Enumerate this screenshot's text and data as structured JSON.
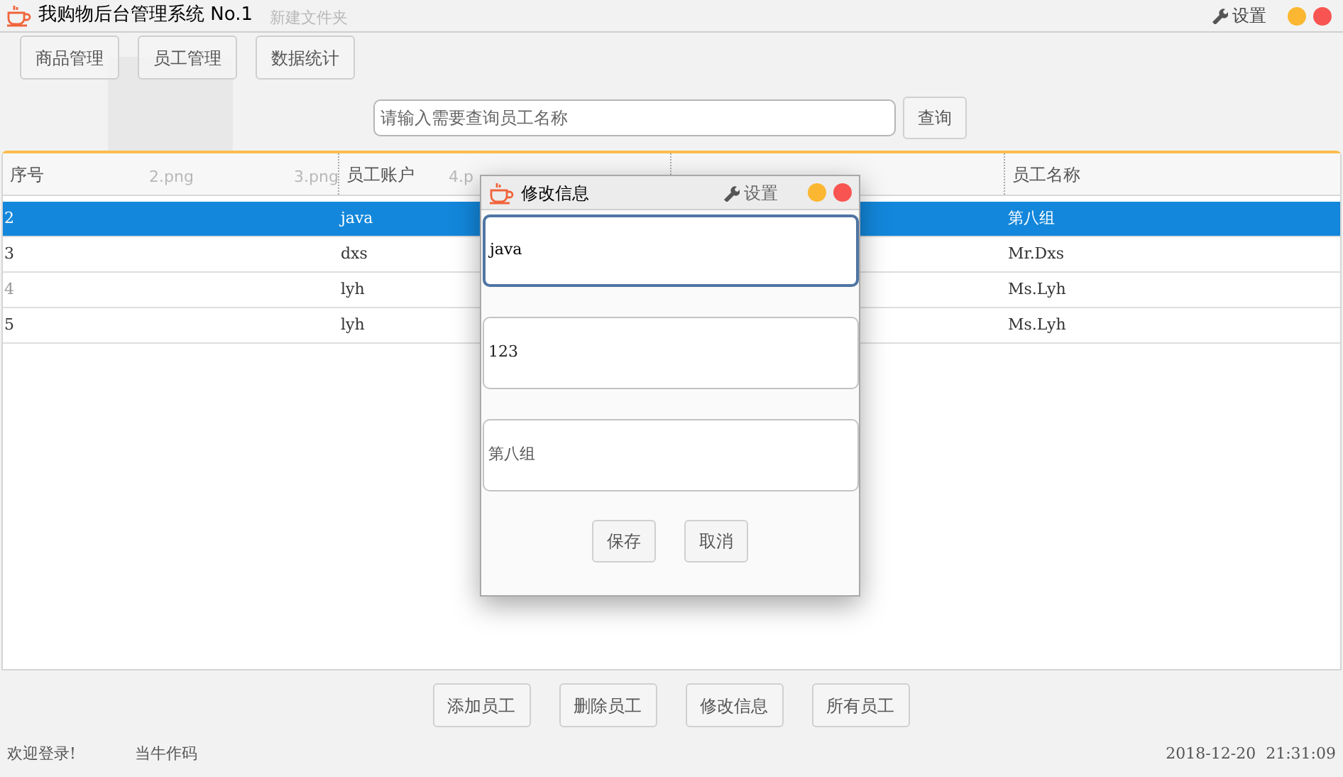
{
  "window": {
    "title": "我购物后台管理系统 No.1",
    "settings": "设置"
  },
  "desktop_behind": [
    {
      "label": "新建文件夹"
    },
    {
      "label": "2.png"
    },
    {
      "label": "3.png"
    },
    {
      "label": "4.p"
    }
  ],
  "nav_buttons": [
    "商品管理",
    "员工管理",
    "数据统计"
  ],
  "search": {
    "placeholder": "请输入需要查询员工名称",
    "button": "查询"
  },
  "table": {
    "columns": [
      "序号",
      "员工账户",
      null,
      "员工名称"
    ],
    "rows": [
      {
        "cells": [
          "2",
          "java",
          "",
          "第八组"
        ],
        "selected": true
      },
      {
        "cells": [
          "3",
          "dxs",
          "",
          "Mr.Dxs"
        ],
        "selected": false
      },
      {
        "cells": [
          "4",
          "lyh",
          "",
          "Ms.Lyh"
        ],
        "selected": false
      },
      {
        "cells": [
          "5",
          "lyh",
          "",
          "Ms.Lyh"
        ],
        "selected": false
      }
    ]
  },
  "actions": [
    "添加员工",
    "删除员工",
    "修改信息",
    "所有员工"
  ],
  "status_bar": {
    "welcome": "欢迎登录!",
    "author": "当牛作码",
    "datetime": "2018-12-20  21:31:09"
  },
  "dialog": {
    "title": "修改信息",
    "settings": "设置",
    "fields": [
      {
        "value": "java",
        "focused": true
      },
      {
        "value": "123",
        "focused": false
      },
      {
        "value": "第八组",
        "focused": false
      }
    ],
    "buttons": [
      "保存",
      "取消"
    ]
  }
}
